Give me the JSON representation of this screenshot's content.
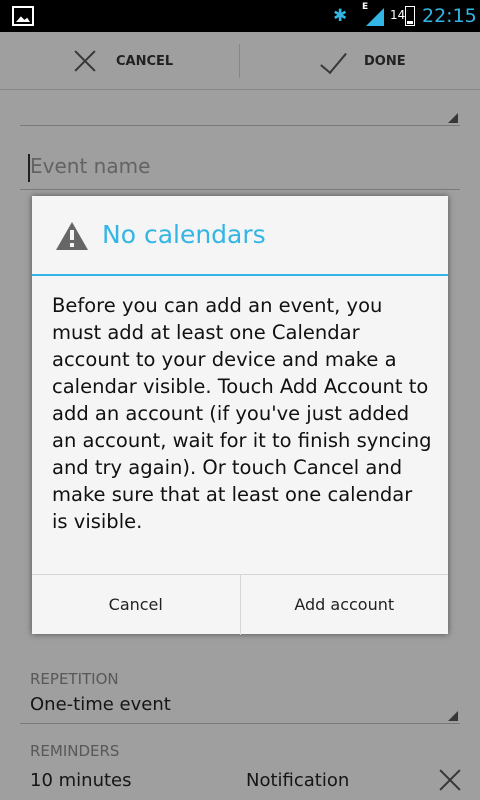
{
  "status_bar": {
    "network_type": "E",
    "battery_level": "14",
    "time": "22:15"
  },
  "action_bar": {
    "cancel_label": "CANCEL",
    "done_label": "DONE"
  },
  "form": {
    "event_name_placeholder": "Event name",
    "repetition_label": "REPETITION",
    "repetition_value": "One-time event",
    "reminders_label": "REMINDERS",
    "reminder_time": "10 minutes",
    "reminder_method": "Notification"
  },
  "dialog": {
    "title": "No calendars",
    "message": "Before you can add an event, you must add at least one Calendar account to your device and make a calendar visible. Touch Add Account to add an account (if you've just added an account, wait for it to finish syncing and try again). Or touch Cancel and make sure that at least one calendar is visible.",
    "cancel_label": "Cancel",
    "add_account_label": "Add account"
  },
  "colors": {
    "accent": "#33b5e5"
  }
}
